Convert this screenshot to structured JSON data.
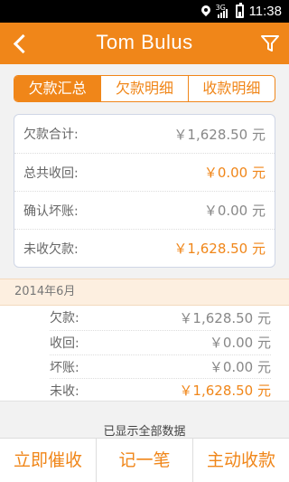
{
  "status_bar": {
    "network": "3G",
    "time": "11:38"
  },
  "header": {
    "title": "Tom Bulus"
  },
  "tabs": [
    {
      "label": "欠款汇总",
      "active": true
    },
    {
      "label": "欠款明细",
      "active": false
    },
    {
      "label": "收款明细",
      "active": false
    }
  ],
  "summary": [
    {
      "label": "欠款合计:",
      "value": "￥1,628.50 元"
    },
    {
      "label": "总共收回:",
      "value": "￥0.00 元"
    },
    {
      "label": "确认坏账:",
      "value": "￥0.00 元"
    },
    {
      "label": "未收欠款:",
      "value": "￥1,628.50 元"
    }
  ],
  "month_header": "2014年6月",
  "month_detail": [
    {
      "label": "欠款:",
      "value": "￥1,628.50 元"
    },
    {
      "label": "收回:",
      "value": "￥0.00 元"
    },
    {
      "label": "坏账:",
      "value": "￥0.00 元"
    },
    {
      "label": "未收:",
      "value": "￥1,628.50 元"
    }
  ],
  "footer_note": "已显示全部数据",
  "bottom_actions": [
    "立即催收",
    "记一笔",
    "主动收款"
  ],
  "colors": {
    "accent": "#f08619",
    "background": "#f2f2f2"
  }
}
